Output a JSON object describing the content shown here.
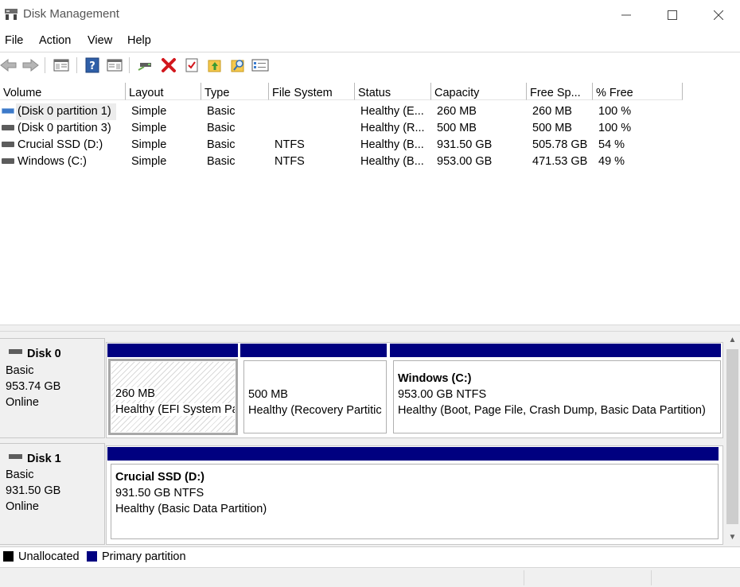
{
  "window": {
    "title": "Disk Management",
    "app_icon": "disk-management-icon",
    "controls": [
      "minimize-icon",
      "maximize-icon",
      "close-icon"
    ]
  },
  "menu": [
    "File",
    "Action",
    "View",
    "Help"
  ],
  "toolbar": [
    "back-arrow-icon",
    "forward-arrow-icon",
    "show-hide-console-tree-icon",
    "help-icon",
    "show-hide-action-pane-icon",
    "connect-virtual-disk-icon",
    "delete-icon",
    "check-icon",
    "folder-up-icon",
    "folder-search-icon",
    "properties-icon"
  ],
  "columns": [
    "Volume",
    "Layout",
    "Type",
    "File System",
    "Status",
    "Capacity",
    "Free Sp...",
    "% Free"
  ],
  "volumes": [
    {
      "volume": "(Disk 0 partition 1)",
      "layout": "Simple",
      "type": "Basic",
      "fs": "",
      "status": "Healthy (E...",
      "capacity": "260 MB",
      "free": "260 MB",
      "pct": "100 %"
    },
    {
      "volume": "(Disk 0 partition 3)",
      "layout": "Simple",
      "type": "Basic",
      "fs": "",
      "status": "Healthy (R...",
      "capacity": "500 MB",
      "free": "500 MB",
      "pct": "100 %"
    },
    {
      "volume": "Crucial SSD (D:)",
      "layout": "Simple",
      "type": "Basic",
      "fs": "NTFS",
      "status": "Healthy (B...",
      "capacity": "931.50 GB",
      "free": "505.78 GB",
      "pct": "54 %"
    },
    {
      "volume": "Windows (C:)",
      "layout": "Simple",
      "type": "Basic",
      "fs": "NTFS",
      "status": "Healthy (B...",
      "capacity": "953.00 GB",
      "free": "471.53 GB",
      "pct": "49 %"
    }
  ],
  "disks": [
    {
      "name": "Disk 0",
      "kind": "Basic",
      "size": "953.74 GB",
      "state": "Online",
      "partitions": [
        {
          "title": "",
          "size": "260 MB",
          "status": "Healthy (EFI System Pa"
        },
        {
          "title": "",
          "size": "500 MB",
          "status": "Healthy (Recovery Partitic"
        },
        {
          "title": "Windows  (C:)",
          "size": "953.00 GB NTFS",
          "status": "Healthy (Boot, Page File, Crash Dump, Basic Data Partition)"
        }
      ]
    },
    {
      "name": "Disk 1",
      "kind": "Basic",
      "size": "931.50 GB",
      "state": "Online",
      "partitions": [
        {
          "title": "Crucial SSD  (D:)",
          "size": "931.50 GB NTFS",
          "status": "Healthy (Basic Data Partition)"
        }
      ]
    }
  ],
  "legend": [
    {
      "label": "Unallocated",
      "color": "#000000"
    },
    {
      "label": "Primary partition",
      "color": "#000080"
    }
  ],
  "colors": {
    "primary_partition": "#000080",
    "selection": "#ececec"
  }
}
